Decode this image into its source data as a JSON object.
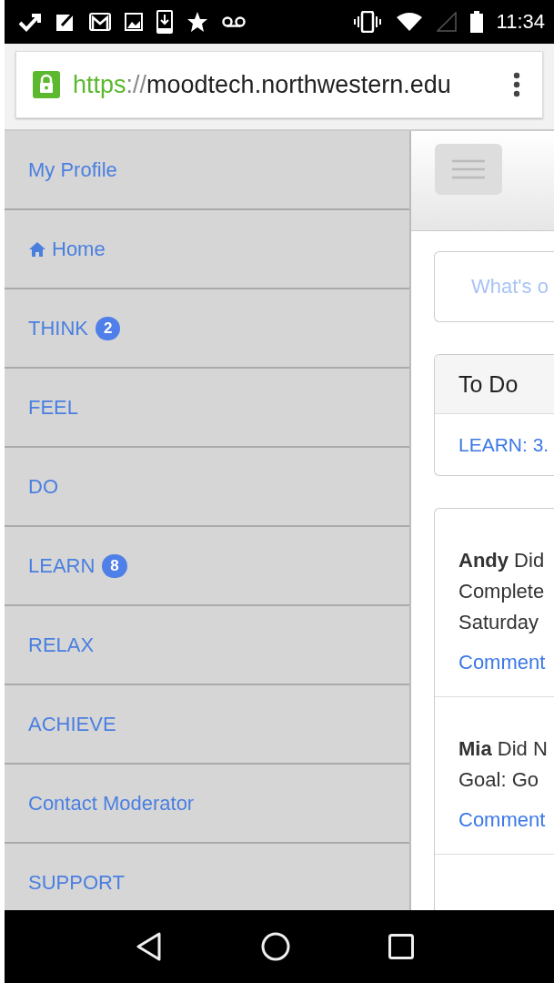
{
  "status_bar": {
    "time": "11:34"
  },
  "address_bar": {
    "scheme": "https",
    "separator": "://",
    "host": "moodtech.northwestern.edu",
    "secure": true
  },
  "sidebar": {
    "items": [
      {
        "label": "My Profile",
        "kind": "link"
      },
      {
        "label": "Home",
        "kind": "home"
      },
      {
        "label": "THINK",
        "kind": "link",
        "badge": "2"
      },
      {
        "label": "FEEL",
        "kind": "link"
      },
      {
        "label": "DO",
        "kind": "link"
      },
      {
        "label": "LEARN",
        "kind": "link",
        "badge": "8"
      },
      {
        "label": "RELAX",
        "kind": "link"
      },
      {
        "label": "ACHIEVE",
        "kind": "link"
      },
      {
        "label": "Contact Moderator",
        "kind": "link"
      },
      {
        "label": "SUPPORT",
        "kind": "link"
      }
    ]
  },
  "main": {
    "status_input": {
      "placeholder": "What's o"
    },
    "todo": {
      "title": "To Do",
      "items": [
        "LEARN: 3."
      ]
    },
    "feed": [
      {
        "lines": [
          "**Andy** Did",
          "Complete",
          "Saturday"
        ],
        "action": "Comment"
      },
      {
        "lines": [
          "**Mia** Did N",
          "Goal: Go"
        ],
        "action": "Comment"
      }
    ]
  }
}
